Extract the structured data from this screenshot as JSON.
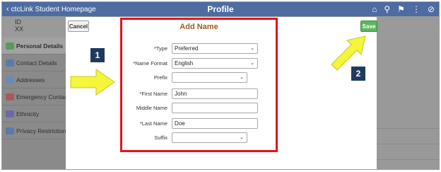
{
  "header": {
    "back_label": "ctcLink Student Homepage",
    "title": "Profile"
  },
  "background": {
    "id_label": "ID",
    "id_value": "XX",
    "sidebar_items": [
      {
        "label": "Personal Details",
        "active": true
      },
      {
        "label": "Contact Details"
      },
      {
        "label": "Addresses"
      },
      {
        "label": "Emergency Contacts"
      },
      {
        "label": "Ethnicity"
      },
      {
        "label": "Privacy Restrictions"
      }
    ]
  },
  "modal": {
    "title": "Add Name",
    "cancel_label": "Cancel",
    "save_label": "Save",
    "fields": {
      "type": {
        "label": "*Type",
        "value": "Preferred"
      },
      "name_format": {
        "label": "*Name Format",
        "value": "English"
      },
      "prefix": {
        "label": "Prefix",
        "value": ""
      },
      "first_name": {
        "label": "*First Name",
        "value": "John"
      },
      "middle_name": {
        "label": "Middle Name",
        "value": ""
      },
      "last_name": {
        "label": "*Last Name",
        "value": "Doe"
      },
      "suffix": {
        "label": "Suffix",
        "value": ""
      }
    }
  },
  "annotations": {
    "step1": "1",
    "step2": "2"
  },
  "colors": {
    "header_bg": "#4d6ca1",
    "highlight_border": "#e3141c",
    "title_color": "#9a5b22",
    "save_bg": "#5cb85c",
    "arrow_fill": "#f5f53a",
    "callout_bg": "#1f3a5f"
  },
  "icons": [
    "back-chevron-icon",
    "home-icon",
    "search-icon",
    "flag-icon",
    "more-icon",
    "navigation-icon"
  ]
}
